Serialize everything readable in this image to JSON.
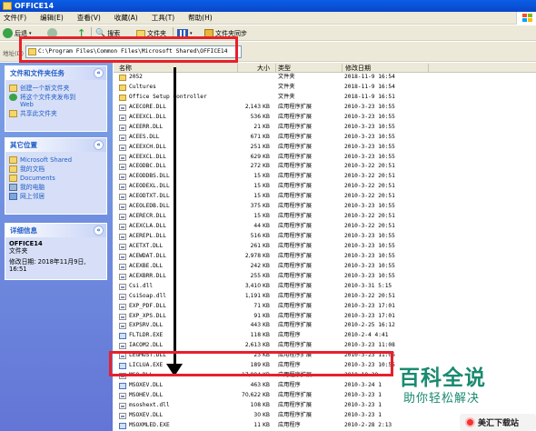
{
  "window": {
    "title": "OFFICE14"
  },
  "menu": [
    "文件(F)",
    "编辑(E)",
    "查看(V)",
    "收藏(A)",
    "工具(T)",
    "帮助(H)"
  ],
  "toolbar": {
    "back": "后退",
    "search": "搜索",
    "folders": "文件夹",
    "sync": "文件夹同步"
  },
  "address": {
    "label": "地址(D)",
    "path": "C:\\Program Files\\Common Files\\Microsoft Shared\\OFFICE14"
  },
  "tasks": {
    "title": "文件和文件夹任务",
    "items": [
      "创建一个新文件夹",
      "将这个文件夹发布到\nWeb",
      "共享此文件夹"
    ]
  },
  "places": {
    "title": "其它位置",
    "items": [
      "Microsoft Shared",
      "我的文档",
      "Documents",
      "我的电脑",
      "网上邻居"
    ]
  },
  "details": {
    "title": "详细信息",
    "name": "OFFICE14",
    "kind": "文件夹",
    "modified": "修改日期: 2018年11月9日,\n16:51"
  },
  "columns": {
    "name": "名称",
    "size": "大小",
    "type": "类型",
    "date": "修改日期"
  },
  "files": [
    {
      "name": "2052",
      "size": "",
      "type": "文件夹",
      "date": "2018-11-9 16:54",
      "icon": "folder"
    },
    {
      "name": "Cultures",
      "size": "",
      "type": "文件夹",
      "date": "2018-11-9 16:54",
      "icon": "folder"
    },
    {
      "name": "Office Setup Controller",
      "size": "",
      "type": "文件夹",
      "date": "2018-11-9 16:51",
      "icon": "folder"
    },
    {
      "name": "ACECORE.DLL",
      "size": "2,143 KB",
      "type": "应用程序扩展",
      "date": "2010-3-23 10:55",
      "icon": "file"
    },
    {
      "name": "ACEEXCL.DLL",
      "size": "536 KB",
      "type": "应用程序扩展",
      "date": "2010-3-23 10:55",
      "icon": "file"
    },
    {
      "name": "ACEERR.DLL",
      "size": "21 KB",
      "type": "应用程序扩展",
      "date": "2010-3-23 10:55",
      "icon": "file"
    },
    {
      "name": "ACEES.DLL",
      "size": "671 KB",
      "type": "应用程序扩展",
      "date": "2010-3-23 10:55",
      "icon": "file"
    },
    {
      "name": "ACEEXCH.DLL",
      "size": "251 KB",
      "type": "应用程序扩展",
      "date": "2010-3-23 10:55",
      "icon": "file"
    },
    {
      "name": "ACEEXCL.DLL",
      "size": "629 KB",
      "type": "应用程序扩展",
      "date": "2010-3-23 10:55",
      "icon": "file"
    },
    {
      "name": "ACEODBC.DLL",
      "size": "272 KB",
      "type": "应用程序扩展",
      "date": "2010-3-22 20:51",
      "icon": "file"
    },
    {
      "name": "ACEODDBS.DLL",
      "size": "15 KB",
      "type": "应用程序扩展",
      "date": "2010-3-22 20:51",
      "icon": "file"
    },
    {
      "name": "ACEODEXL.DLL",
      "size": "15 KB",
      "type": "应用程序扩展",
      "date": "2010-3-22 20:51",
      "icon": "file"
    },
    {
      "name": "ACEODTXT.DLL",
      "size": "15 KB",
      "type": "应用程序扩展",
      "date": "2010-3-22 20:51",
      "icon": "file"
    },
    {
      "name": "ACEOLEDB.DLL",
      "size": "375 KB",
      "type": "应用程序扩展",
      "date": "2010-3-23 10:55",
      "icon": "file"
    },
    {
      "name": "ACERECR.DLL",
      "size": "15 KB",
      "type": "应用程序扩展",
      "date": "2010-3-22 20:51",
      "icon": "file"
    },
    {
      "name": "ACEXCLA.DLL",
      "size": "44 KB",
      "type": "应用程序扩展",
      "date": "2010-3-22 20:51",
      "icon": "file"
    },
    {
      "name": "ACEREPL.DLL",
      "size": "516 KB",
      "type": "应用程序扩展",
      "date": "2010-3-23 10:55",
      "icon": "file"
    },
    {
      "name": "ACETXT.DLL",
      "size": "261 KB",
      "type": "应用程序扩展",
      "date": "2010-3-23 10:55",
      "icon": "file"
    },
    {
      "name": "ACEWDAT.DLL",
      "size": "2,978 KB",
      "type": "应用程序扩展",
      "date": "2010-3-23 10:55",
      "icon": "file"
    },
    {
      "name": "ACEXBE.DLL",
      "size": "242 KB",
      "type": "应用程序扩展",
      "date": "2010-3-23 10:55",
      "icon": "file"
    },
    {
      "name": "ACEXBRR.DLL",
      "size": "255 KB",
      "type": "应用程序扩展",
      "date": "2010-3-23 10:55",
      "icon": "file"
    },
    {
      "name": "Csi.dll",
      "size": "3,410 KB",
      "type": "应用程序扩展",
      "date": "2010-3-31 5:15",
      "icon": "file"
    },
    {
      "name": "CsiSoap.dll",
      "size": "1,191 KB",
      "type": "应用程序扩展",
      "date": "2010-3-22 20:51",
      "icon": "file"
    },
    {
      "name": "EXP_PDF.DLL",
      "size": "71 KB",
      "type": "应用程序扩展",
      "date": "2010-3-23 17:01",
      "icon": "file"
    },
    {
      "name": "EXP_XPS.DLL",
      "size": "91 KB",
      "type": "应用程序扩展",
      "date": "2010-3-23 17:01",
      "icon": "file"
    },
    {
      "name": "EXPSRV.DLL",
      "size": "443 KB",
      "type": "应用程序扩展",
      "date": "2010-2-25 16:12",
      "icon": "file"
    },
    {
      "name": "FLTLDR.EXE",
      "size": "118 KB",
      "type": "应用程序",
      "date": "2010-2-4 4:41",
      "icon": "exe"
    },
    {
      "name": "IACOM2.DLL",
      "size": "2,613 KB",
      "type": "应用程序扩展",
      "date": "2010-3-23 11:08",
      "icon": "file"
    },
    {
      "name": "LEGMOST.DLL",
      "size": "23 KB",
      "type": "应用程序扩展",
      "date": "2010-3-23 11:06",
      "icon": "file"
    },
    {
      "name": "LICLUA.EXE",
      "size": "189 KB",
      "type": "应用程序",
      "date": "2010-3-23 10:55",
      "icon": "exe"
    },
    {
      "name": "MSO.DLL",
      "size": "17,994 KB",
      "type": "应用程序扩展",
      "date": "2010-10-20",
      "icon": "file"
    },
    {
      "name": "MSOXEV.DLL",
      "size": "463 KB",
      "type": "应用程序",
      "date": "2010-3-24 1",
      "icon": "exe"
    },
    {
      "name": "MSOHEV.DLL",
      "size": "70,622 KB",
      "type": "应用程序扩展",
      "date": "2010-3-23 1",
      "icon": "file"
    },
    {
      "name": "msoshext.dll",
      "size": "108 KB",
      "type": "应用程序扩展",
      "date": "2010-3-23 1",
      "icon": "file"
    },
    {
      "name": "MSOXEV.DLL",
      "size": "30 KB",
      "type": "应用程序扩展",
      "date": "2010-3-23 1",
      "icon": "file"
    },
    {
      "name": "MSOXMLED.EXE",
      "size": "11 KB",
      "type": "应用程序",
      "date": "2010-2-28 2:13",
      "icon": "exe"
    },
    {
      "name": "MSOXMLMF.DLL",
      "size": "11 KB",
      "type": "应用程序扩展",
      "date": "2010-2-28 2:13",
      "icon": "file"
    }
  ],
  "watermark": {
    "title": "百科全说",
    "subtitle": "助你轻松解决",
    "badge": "美汇下载站"
  }
}
